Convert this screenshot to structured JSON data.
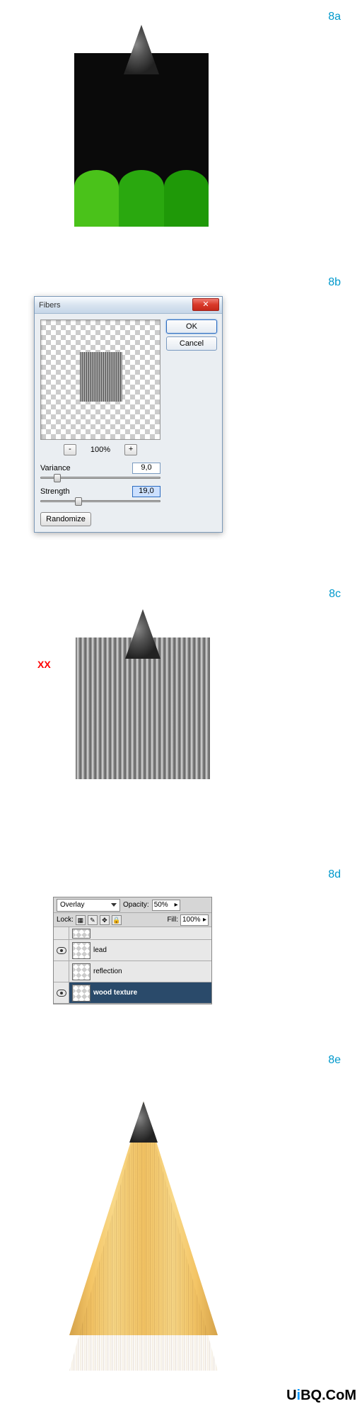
{
  "steps": {
    "a": "8a",
    "b": "8b",
    "c": "8c",
    "d": "8d",
    "e": "8e"
  },
  "annotation_xx": "XX",
  "fibers_dialog": {
    "title": "Fibers",
    "ok": "OK",
    "cancel": "Cancel",
    "zoom_minus": "-",
    "zoom_plus": "+",
    "zoom_pct": "100%",
    "variance_label": "Variance",
    "variance_value": "9,0",
    "strength_label": "Strength",
    "strength_value": "19,0",
    "randomize": "Randomize"
  },
  "layers_panel": {
    "blend_mode": "Overlay",
    "opacity_label": "Opacity:",
    "opacity_value": "50%",
    "lock_label": "Lock:",
    "fill_label": "Fill:",
    "fill_value": "100%",
    "layers": [
      {
        "name": "lead",
        "visible": true
      },
      {
        "name": "reflection",
        "visible": false
      },
      {
        "name": "wood texture",
        "visible": true,
        "selected": true
      }
    ]
  },
  "watermark": {
    "pre": "U",
    "accent": "i",
    "post": "BQ.CoM"
  }
}
